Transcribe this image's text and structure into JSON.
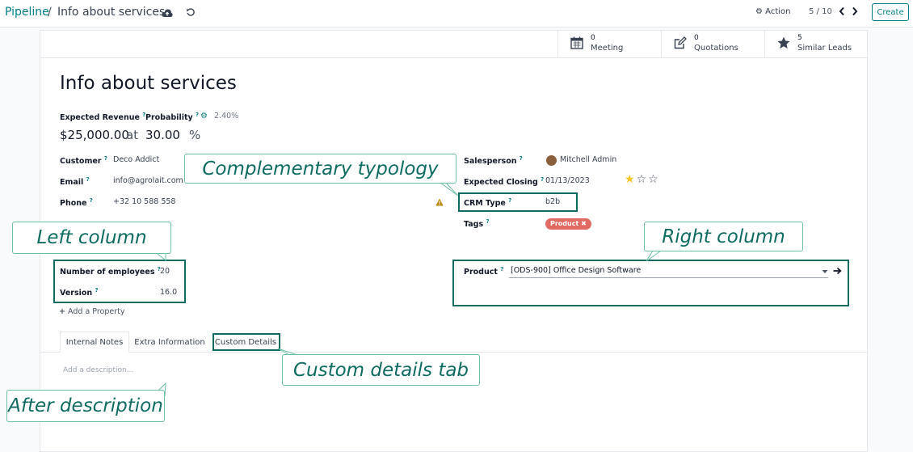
{
  "breadcrumb": {
    "parent": "Pipeline",
    "separator": "/",
    "current": "Info about services"
  },
  "toolbar": {
    "action_label": "Action",
    "pager": "5 / 10",
    "create_label": "Create"
  },
  "stats": [
    {
      "count": "0",
      "label": "Meeting",
      "icon": "calendar-icon"
    },
    {
      "count": "0",
      "label": "Quotations",
      "icon": "pencil-square-icon"
    },
    {
      "count": "5",
      "label": "Similar Leads",
      "icon": "star-icon"
    }
  ],
  "lead": {
    "title": "Info about services",
    "expected_revenue_label": "Expected Revenue",
    "probability_label": "Probability",
    "probability_auto": "2.40%",
    "revenue_value": "$25,000.00",
    "at": "at",
    "probability_value": "30.00",
    "percent": "%"
  },
  "left_fields": {
    "customer_label": "Customer",
    "customer_value": "Deco Addict",
    "email_label": "Email",
    "email_value": "info@agrolait.com",
    "phone_label": "Phone",
    "phone_value": "+32 10 588 558"
  },
  "right_fields": {
    "salesperson_label": "Salesperson",
    "salesperson_value": "Mitchell Admin",
    "expected_closing_label": "Expected Closing",
    "expected_closing_value": "01/13/2023",
    "priority_stars": 1,
    "crm_type_label": "CRM Type",
    "crm_type_value": "b2b",
    "tags_label": "Tags",
    "tag_value": "Product",
    "product_label": "Product",
    "product_value": "[ODS-900] Office Design Software"
  },
  "custom_left": {
    "employees_label": "Number of employees",
    "employees_value": "20",
    "version_label": "Version",
    "version_value": "16.0",
    "add_property": "Add a Property"
  },
  "tabs": [
    "Internal Notes",
    "Extra Information",
    "Custom Details"
  ],
  "description_placeholder": "Add a description...",
  "callouts": {
    "complementary": "Complementary typology",
    "left_column": "Left column",
    "right_column": "Right column",
    "custom_details_tab": "Custom details tab",
    "after_description": "After description"
  },
  "colors": {
    "brand": "#017e84",
    "highlight": "#0f6b61",
    "callout_text": "#0e6b60",
    "tag": "#e16b63",
    "warning": "#b58a00",
    "star": "#f3c623"
  }
}
